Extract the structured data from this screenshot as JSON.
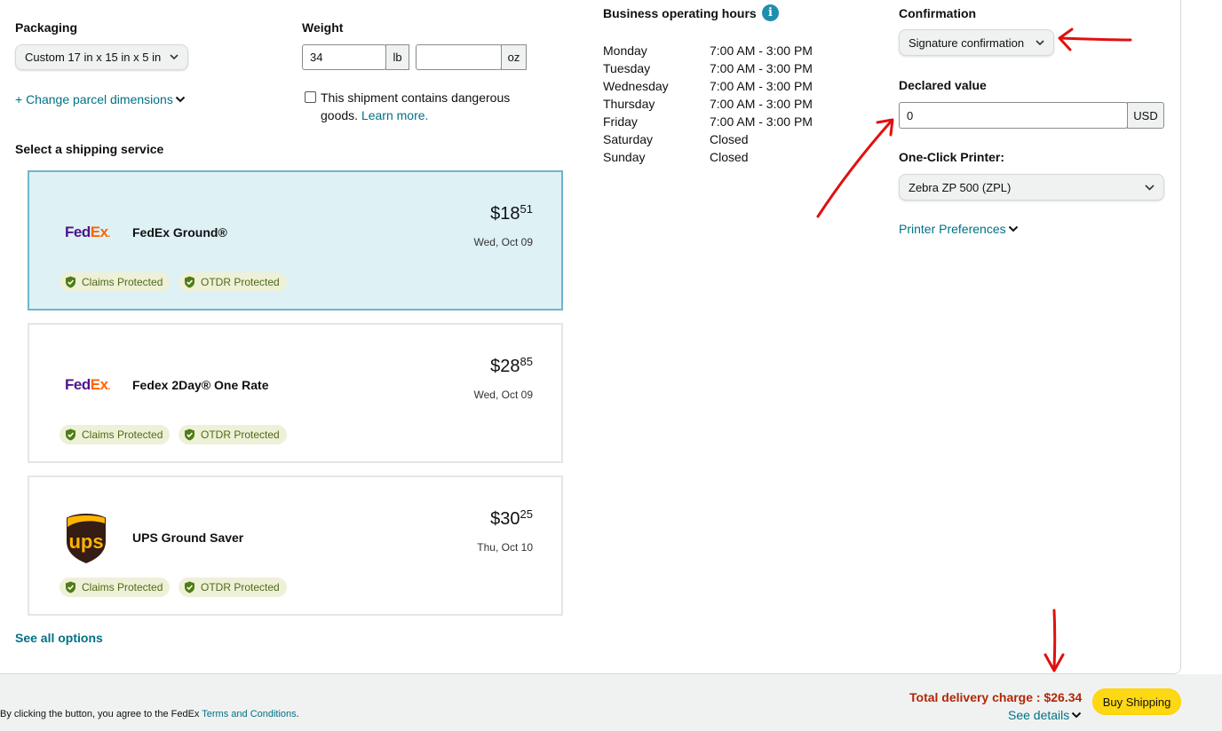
{
  "packaging": {
    "label": "Packaging",
    "selected": "Custom 17 in x 15 in x 5 in",
    "change_dimensions_link": "+ Change parcel dimensions"
  },
  "weight": {
    "label": "Weight",
    "lb_value": "34",
    "lb_unit": "lb",
    "oz_value": "",
    "oz_unit": "oz",
    "dangerous_goods_text_1": "This shipment contains dangerous",
    "dangerous_goods_text_2": "goods.",
    "learn_more": "Learn more."
  },
  "shipping": {
    "section_title": "Select a shipping service",
    "services": [
      {
        "carrier": "FedEx",
        "name": "FedEx Ground®",
        "price_dollars": "$18",
        "price_cents": "51",
        "date": "Wed, Oct 09",
        "selected": true,
        "badges": [
          "Claims Protected",
          "OTDR Protected"
        ]
      },
      {
        "carrier": "FedEx",
        "name": "Fedex 2Day® One Rate",
        "price_dollars": "$28",
        "price_cents": "85",
        "date": "Wed, Oct 09",
        "selected": false,
        "badges": [
          "Claims Protected",
          "OTDR Protected"
        ]
      },
      {
        "carrier": "UPS",
        "name": "UPS Ground Saver",
        "price_dollars": "$30",
        "price_cents": "25",
        "date": "Thu, Oct 10",
        "selected": false,
        "badges": [
          "Claims Protected",
          "OTDR Protected"
        ]
      }
    ],
    "see_all_options": "See all options"
  },
  "logos": {
    "fedex_fed": "Fed",
    "fedex_ex": "Ex",
    "fedex_dot": ".",
    "ups": "ups"
  },
  "hours": {
    "title": "Business operating hours",
    "info_glyph": "i",
    "days": [
      {
        "day": "Monday",
        "time": "7:00 AM - 3:00 PM"
      },
      {
        "day": "Tuesday",
        "time": "7:00 AM - 3:00 PM"
      },
      {
        "day": "Wednesday",
        "time": "7:00 AM - 3:00 PM"
      },
      {
        "day": "Thursday",
        "time": "7:00 AM - 3:00 PM"
      },
      {
        "day": "Friday",
        "time": "7:00 AM - 3:00 PM"
      },
      {
        "day": "Saturday",
        "time": "Closed"
      },
      {
        "day": "Sunday",
        "time": "Closed"
      }
    ]
  },
  "confirmation": {
    "label": "Confirmation",
    "selected": "Signature confirmation"
  },
  "declared_value": {
    "label": "Declared value",
    "value": "0",
    "currency": "USD"
  },
  "printer": {
    "label": "One-Click Printer:",
    "selected": "Zebra ZP 500 (ZPL)",
    "preferences_link": "Printer Preferences"
  },
  "footer": {
    "terms_prefix": "By clicking the button, you agree to the FedEx",
    "terms_link": "Terms and Conditions",
    "terms_suffix": ".",
    "total_label": "Total delivery charge : $26.34",
    "see_details": "See details",
    "buy_button": "Buy Shipping"
  },
  "colors": {
    "accent_link": "#007185",
    "selected_card_bg": "#def1f5",
    "buy_button": "#ffd814",
    "total_charge": "#b12704",
    "annotation": "#e01010"
  },
  "icons": {
    "chevron": "chevron-down-icon",
    "shield": "shield-check-icon",
    "info": "info-icon"
  }
}
